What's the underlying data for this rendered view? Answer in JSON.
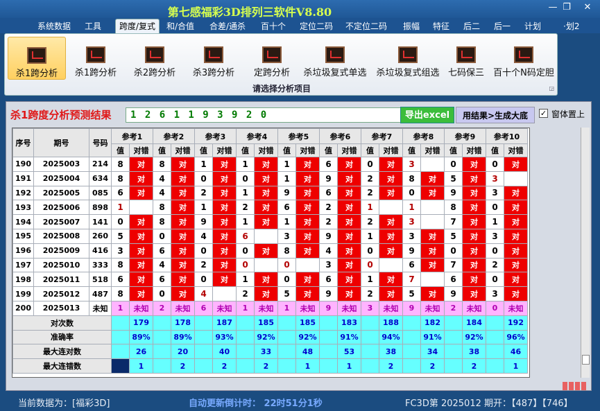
{
  "window": {
    "title": "第七感福彩3D排列三软件V8.80",
    "min": "—",
    "restore": "❐",
    "close": "✕"
  },
  "menu": [
    "系统数据",
    "工具",
    "跨度/复式",
    "和/合值",
    "合差/通杀",
    "百十个",
    "定位二码",
    "不定位二码",
    "振幅",
    "特征",
    "后二",
    "后一",
    "计划",
    "·划2"
  ],
  "menu_active": 2,
  "ribbon": {
    "buttons": [
      "杀1跨分析",
      "杀1跨分析",
      "杀2跨分析",
      "杀3跨分析",
      "定跨分析",
      "杀垃圾复式单选",
      "杀垃圾复式组选",
      "七码保三",
      "百十个N码定胆"
    ],
    "group_label": "请选择分析项目",
    "selected": 0
  },
  "result": {
    "label": "杀1跨度分析预测结果",
    "value": "1 2 6 1 1 9 3 9 2 0",
    "export_button": "导出excel",
    "generate_button": "用结果>生成大底",
    "topmost_label": "窗体置上",
    "topmost_checked": true
  },
  "grid": {
    "fixed_headers": [
      "序号",
      "期号",
      "号码"
    ],
    "ref_headers": [
      "参考1",
      "参考2",
      "参考3",
      "参考4",
      "参考5",
      "参考6",
      "参考7",
      "参考8",
      "参考9",
      "参考10"
    ],
    "sub_headers": [
      "值",
      "对错"
    ],
    "rows": [
      {
        "seq": "190",
        "issue": "2025003",
        "num": "214",
        "vals": [
          "8",
          "8",
          "1",
          "1",
          "1",
          "6",
          "0",
          "3",
          "0",
          "0"
        ],
        "hits": [
          1,
          1,
          1,
          1,
          1,
          1,
          1,
          0,
          1,
          1
        ],
        "red": [
          0,
          0,
          0,
          0,
          0,
          0,
          0,
          1,
          0,
          0
        ]
      },
      {
        "seq": "191",
        "issue": "2025004",
        "num": "634",
        "vals": [
          "8",
          "4",
          "0",
          "0",
          "1",
          "9",
          "2",
          "8",
          "5",
          "3"
        ],
        "hits": [
          1,
          1,
          1,
          1,
          1,
          1,
          1,
          1,
          1,
          0
        ],
        "red": [
          0,
          0,
          0,
          0,
          0,
          0,
          0,
          0,
          0,
          1
        ]
      },
      {
        "seq": "192",
        "issue": "2025005",
        "num": "085",
        "vals": [
          "6",
          "4",
          "2",
          "1",
          "9",
          "6",
          "2",
          "0",
          "9",
          "3"
        ],
        "hits": [
          1,
          1,
          1,
          1,
          1,
          1,
          1,
          1,
          1,
          1
        ],
        "red": [
          0,
          0,
          0,
          0,
          0,
          0,
          0,
          0,
          0,
          0
        ]
      },
      {
        "seq": "193",
        "issue": "2025006",
        "num": "898",
        "vals": [
          "1",
          "8",
          "1",
          "2",
          "6",
          "2",
          "1",
          "1",
          "8",
          "0"
        ],
        "hits": [
          0,
          1,
          1,
          1,
          1,
          1,
          0,
          0,
          1,
          1
        ],
        "red": [
          1,
          0,
          0,
          0,
          0,
          0,
          1,
          1,
          0,
          0
        ]
      },
      {
        "seq": "194",
        "issue": "2025007",
        "num": "141",
        "vals": [
          "0",
          "8",
          "9",
          "1",
          "1",
          "2",
          "2",
          "3",
          "7",
          "1"
        ],
        "hits": [
          1,
          1,
          1,
          1,
          1,
          1,
          1,
          0,
          1,
          1
        ],
        "red": [
          0,
          0,
          0,
          0,
          0,
          0,
          0,
          1,
          0,
          0
        ]
      },
      {
        "seq": "195",
        "issue": "2025008",
        "num": "260",
        "vals": [
          "5",
          "0",
          "4",
          "6",
          "3",
          "9",
          "1",
          "3",
          "5",
          "3"
        ],
        "hits": [
          1,
          1,
          1,
          0,
          1,
          1,
          1,
          1,
          1,
          1
        ],
        "red": [
          0,
          0,
          0,
          1,
          0,
          0,
          0,
          0,
          0,
          0
        ]
      },
      {
        "seq": "196",
        "issue": "2025009",
        "num": "416",
        "vals": [
          "3",
          "6",
          "0",
          "0",
          "8",
          "4",
          "0",
          "9",
          "0",
          "0"
        ],
        "hits": [
          1,
          1,
          1,
          1,
          1,
          1,
          1,
          1,
          1,
          1
        ],
        "red": [
          0,
          0,
          0,
          0,
          0,
          0,
          0,
          0,
          0,
          0
        ]
      },
      {
        "seq": "197",
        "issue": "2025010",
        "num": "333",
        "vals": [
          "8",
          "4",
          "2",
          "0",
          "0",
          "3",
          "0",
          "6",
          "7",
          "2"
        ],
        "hits": [
          1,
          1,
          1,
          0,
          0,
          1,
          0,
          1,
          1,
          1
        ],
        "red": [
          0,
          0,
          0,
          1,
          1,
          0,
          1,
          0,
          0,
          0
        ]
      },
      {
        "seq": "198",
        "issue": "2025011",
        "num": "518",
        "vals": [
          "6",
          "6",
          "0",
          "1",
          "0",
          "6",
          "1",
          "7",
          "6",
          "0"
        ],
        "hits": [
          1,
          1,
          1,
          1,
          1,
          1,
          1,
          0,
          1,
          1
        ],
        "red": [
          0,
          0,
          0,
          0,
          0,
          0,
          0,
          1,
          0,
          0
        ]
      },
      {
        "seq": "199",
        "issue": "2025012",
        "num": "487",
        "vals": [
          "8",
          "0",
          "4",
          "2",
          "5",
          "9",
          "2",
          "5",
          "9",
          "3"
        ],
        "hits": [
          1,
          1,
          0,
          1,
          1,
          1,
          1,
          1,
          1,
          1
        ],
        "red": [
          0,
          0,
          1,
          0,
          0,
          0,
          0,
          0,
          0,
          0
        ]
      }
    ],
    "hit_text": "对",
    "pending_row": {
      "seq": "200",
      "issue": "2025013",
      "num": "未知",
      "vals": [
        "1",
        "2",
        "6",
        "1",
        "1",
        "9",
        "3",
        "9",
        "2",
        "0"
      ],
      "status": "未知"
    },
    "stats": [
      {
        "label": "对次数",
        "values": [
          "179",
          "178",
          "187",
          "185",
          "185",
          "183",
          "188",
          "182",
          "184",
          "192"
        ]
      },
      {
        "label": "准确率",
        "values": [
          "89%",
          "89%",
          "93%",
          "92%",
          "92%",
          "91%",
          "94%",
          "91%",
          "92%",
          "96%"
        ]
      },
      {
        "label": "最大连对数",
        "values": [
          "26",
          "20",
          "40",
          "33",
          "48",
          "53",
          "38",
          "34",
          "38",
          "46"
        ]
      },
      {
        "label": "最大连错数",
        "values": [
          "1",
          "2",
          "2",
          "2",
          "1",
          "1",
          "2",
          "2",
          "2",
          "1"
        ]
      }
    ]
  },
  "status": {
    "left": "当前数据为：[福彩3D]",
    "center": "自动更新倒计时： 22时51分1秒",
    "right": "FC3D第 2025012 期开：【487】【746】"
  }
}
